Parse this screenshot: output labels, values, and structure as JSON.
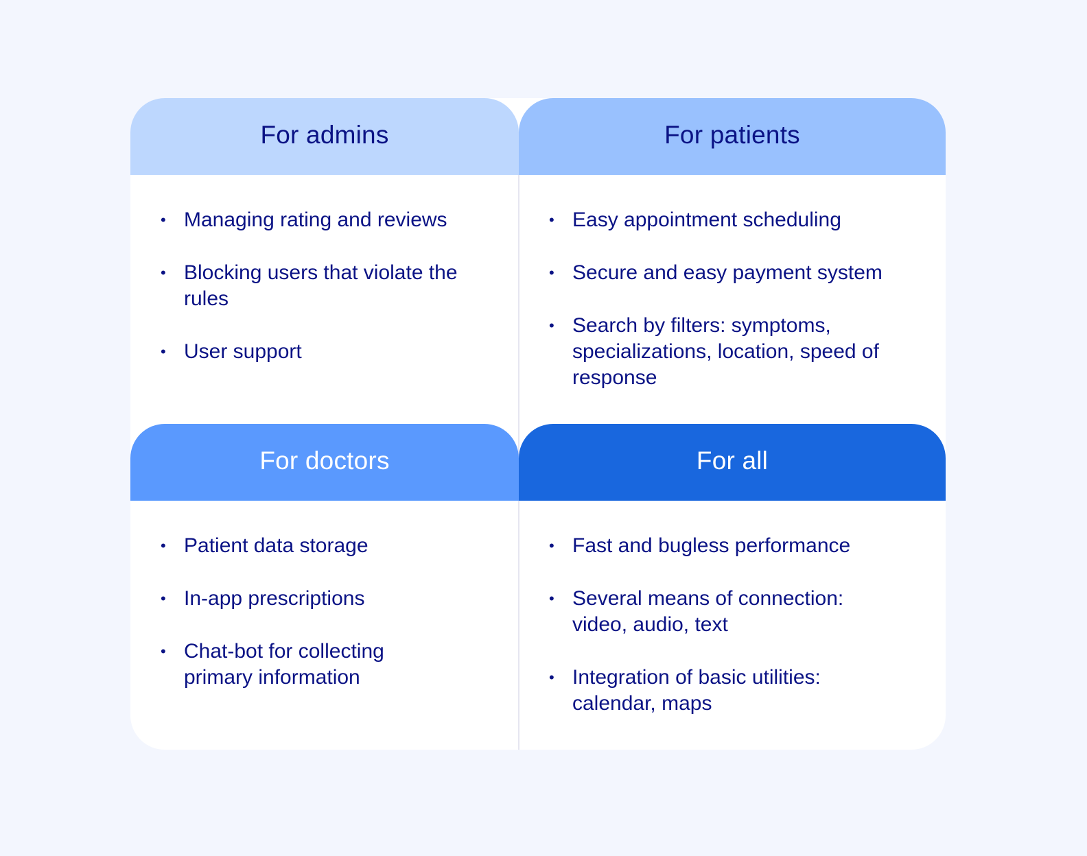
{
  "colors": {
    "background": "#F3F6FE",
    "card": "#FFFFFF",
    "text": "#0B1385",
    "header_admins": "#BDD7FE",
    "header_patients": "#99C1FE",
    "header_doctors": "#5A99FE",
    "header_all": "#1967DE"
  },
  "sections": {
    "admins": {
      "title": "For admins",
      "items": [
        "Managing rating and reviews",
        "Blocking users that violate the rules",
        "User support"
      ]
    },
    "patients": {
      "title": "For patients",
      "items": [
        "Easy appointment scheduling",
        "Secure and easy payment system",
        "Search by filters: symptoms, specializations, location, speed of response"
      ]
    },
    "doctors": {
      "title": "For doctors",
      "items": [
        "Patient data storage",
        "In-app prescriptions",
        "Chat-bot for collecting primary information"
      ]
    },
    "all": {
      "title": "For all",
      "items": [
        "Fast and bugless performance",
        "Several means of connection: video, audio, text",
        "Integration of basic utilities: calendar, maps"
      ]
    }
  },
  "bullet_glyph": "•"
}
